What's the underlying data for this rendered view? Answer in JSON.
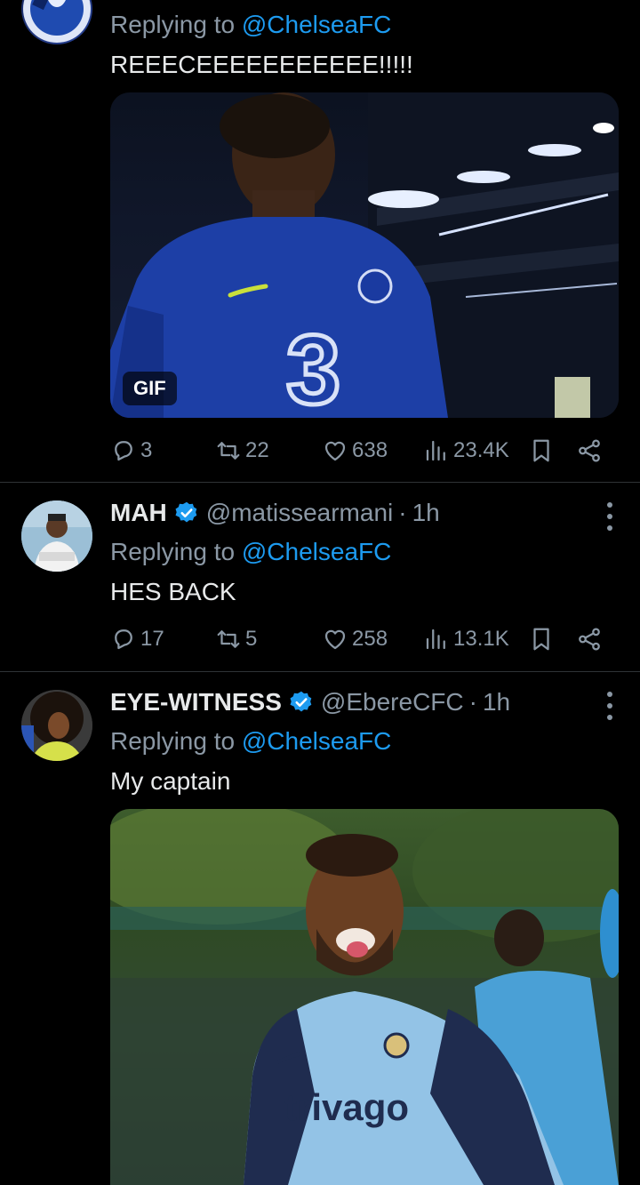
{
  "tweets": [
    {
      "replying_label": "Replying to ",
      "replying_to": "@ChelseaFC",
      "text": "REEECEEEEEEEEEEE!!!!!",
      "media_badge": "GIF",
      "stats": {
        "replies": "3",
        "retweets": "22",
        "likes": "638",
        "views": "23.4K"
      }
    },
    {
      "name": "MAH",
      "handle": "@matissearmani",
      "dot": "·",
      "time": "1h",
      "replying_label": "Replying to ",
      "replying_to": "@ChelseaFC",
      "text": "HES BACK",
      "stats": {
        "replies": "17",
        "retweets": "5",
        "likes": "258",
        "views": "13.1K"
      }
    },
    {
      "name": "EYE-WITNESS",
      "handle": "@EbereCFC",
      "dot": "·",
      "time": "1h",
      "replying_label": "Replying to ",
      "replying_to": "@ChelseaFC",
      "text": "My captain",
      "media_logo": "trivago"
    }
  ],
  "colors": {
    "background": "#000000",
    "primary_text": "#e7e9ea",
    "secondary_text": "#8b98a5",
    "accent": "#1d9bf0",
    "divider": "#2f3336"
  },
  "icons": [
    "reply-icon",
    "retweet-icon",
    "like-icon",
    "views-icon",
    "bookmark-icon",
    "share-icon",
    "verified-icon",
    "more-icon"
  ]
}
